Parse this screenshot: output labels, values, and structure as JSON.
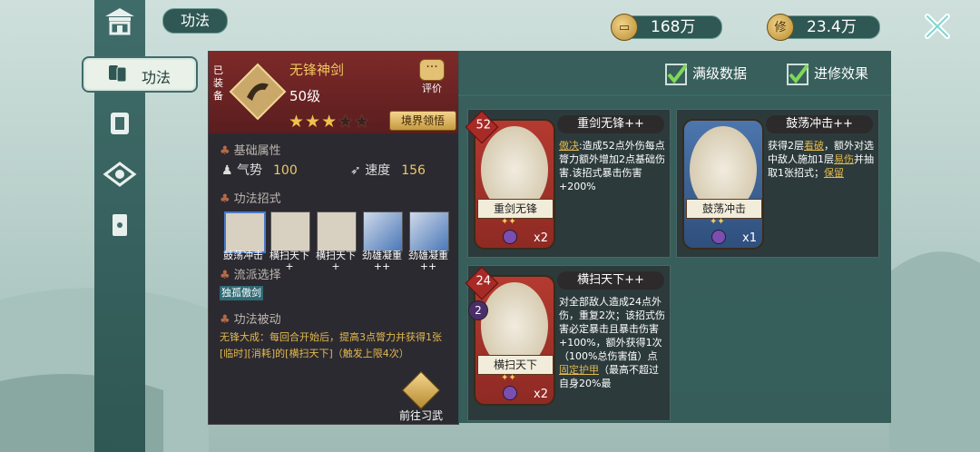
{
  "top": {
    "title": "功法"
  },
  "sidebar": {
    "selected_label": "功法"
  },
  "currency": [
    {
      "icon": "coin-icon",
      "glyph": "▭",
      "value": "168万"
    },
    {
      "icon": "cultivation-coin-icon",
      "glyph": "修",
      "value": "23.4万"
    }
  ],
  "technique": {
    "equipped_tag": "已装备",
    "name": "无锋神剑",
    "level": "50级",
    "stars_filled": 3,
    "stars_total": 5,
    "eval_label": "评价",
    "realm_button": "境界领悟",
    "sections": {
      "base": "基础属性",
      "moves": "功法招式",
      "school": "流派选择",
      "passive": "功法被动"
    },
    "stats": [
      {
        "label": "气势",
        "value": "100"
      },
      {
        "label": "速度",
        "value": "156"
      }
    ],
    "moves": [
      {
        "label": "鼓荡冲击",
        "sub": ""
      },
      {
        "label": "横扫天下",
        "sub": "+"
      },
      {
        "label": "横扫天下",
        "sub": "+"
      },
      {
        "label": "劲雄凝重",
        "sub": "++"
      },
      {
        "label": "劲雄凝重",
        "sub": "++"
      }
    ],
    "school": "独孤傲剑",
    "passive_text": "无锋大成：每回合开始后，提高3点膂力并获得1张[临时][消耗]的[横扫天下]（触发上限4次）",
    "goto_button": "前往习武"
  },
  "toggles": {
    "max_level": "满级数据",
    "advanced": "进修效果"
  },
  "cards": [
    {
      "title": "重剑无锋++",
      "banner": "重剑无锋",
      "cost": "52",
      "count": "x2",
      "kw": "傲决",
      "desc": ":造成52点外伤每点膂力额外增加2点基础伤害.该招式暴击伤害+200%"
    },
    {
      "title": "鼓荡冲击++",
      "banner": "鼓荡冲击",
      "cost": "",
      "count": "x1",
      "d1": "获得2层",
      "kw1": "看破",
      "d2": "，额外对选中敌人施加1层",
      "kw2": "易伤",
      "d3": "并抽取1张招式；",
      "kw3": "保留"
    },
    {
      "title": "横扫天下++",
      "banner": "横扫天下",
      "cost": "24",
      "count": "x2",
      "gem": "2",
      "d1": "对全部敌人造成24点外伤，重复2次；该招式伤害必定暴击且暴击伤害+100%，额外获得1次（100%总伤害值）点",
      "kw1": "固定护甲",
      "d2": "（最高不超过自身20%最"
    }
  ]
}
